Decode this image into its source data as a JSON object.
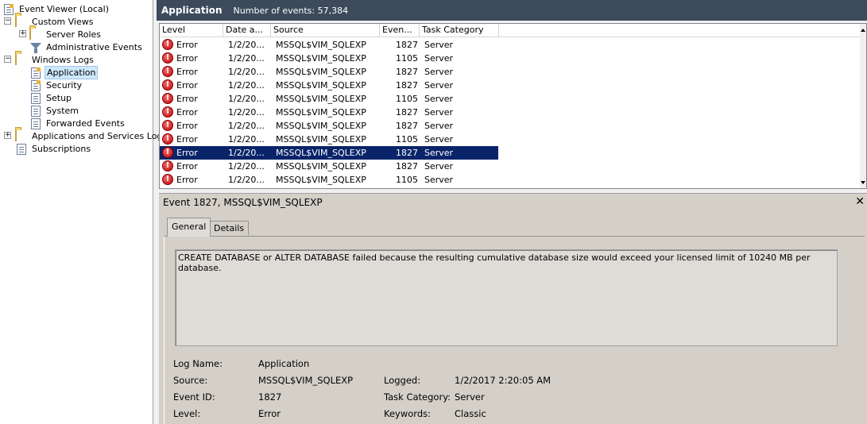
{
  "tree": {
    "items": [
      {
        "label": "Event Viewer (Local)"
      },
      {
        "label": "Custom Views"
      },
      {
        "label": "Server Roles"
      },
      {
        "label": "Administrative Events"
      },
      {
        "label": "Windows Logs"
      },
      {
        "label": "Application"
      },
      {
        "label": "Security"
      },
      {
        "label": "Setup"
      },
      {
        "label": "System"
      },
      {
        "label": "Forwarded Events"
      },
      {
        "label": "Applications and Services Logs"
      },
      {
        "label": "Subscriptions"
      }
    ]
  },
  "header": {
    "title": "Application",
    "count": "Number of events: 57,384"
  },
  "grid": {
    "columns": [
      "Level",
      "Date a...",
      "Source",
      "Even...",
      "Task Category"
    ],
    "rows": [
      {
        "level": "Error",
        "date": "1/2/20...",
        "source": "MSSQL$VIM_SQLEXP",
        "event": "1827",
        "category": "Server"
      },
      {
        "level": "Error",
        "date": "1/2/20...",
        "source": "MSSQL$VIM_SQLEXP",
        "event": "1105",
        "category": "Server"
      },
      {
        "level": "Error",
        "date": "1/2/20...",
        "source": "MSSQL$VIM_SQLEXP",
        "event": "1827",
        "category": "Server"
      },
      {
        "level": "Error",
        "date": "1/2/20...",
        "source": "MSSQL$VIM_SQLEXP",
        "event": "1827",
        "category": "Server"
      },
      {
        "level": "Error",
        "date": "1/2/20...",
        "source": "MSSQL$VIM_SQLEXP",
        "event": "1105",
        "category": "Server"
      },
      {
        "level": "Error",
        "date": "1/2/20...",
        "source": "MSSQL$VIM_SQLEXP",
        "event": "1827",
        "category": "Server"
      },
      {
        "level": "Error",
        "date": "1/2/20...",
        "source": "MSSQL$VIM_SQLEXP",
        "event": "1827",
        "category": "Server"
      },
      {
        "level": "Error",
        "date": "1/2/20...",
        "source": "MSSQL$VIM_SQLEXP",
        "event": "1105",
        "category": "Server"
      },
      {
        "level": "Error",
        "date": "1/2/20...",
        "source": "MSSQL$VIM_SQLEXP",
        "event": "1827",
        "category": "Server"
      },
      {
        "level": "Error",
        "date": "1/2/20...",
        "source": "MSSQL$VIM_SQLEXP",
        "event": "1827",
        "category": "Server"
      },
      {
        "level": "Error",
        "date": "1/2/20...",
        "source": "MSSQL$VIM_SQLEXP",
        "event": "1105",
        "category": "Server"
      }
    ]
  },
  "detail": {
    "title": "Event 1827, MSSQL$VIM_SQLEXP",
    "tabs": [
      "General",
      "Details"
    ],
    "message": "CREATE DATABASE or ALTER DATABASE failed because the resulting cumulative database size would exceed your licensed limit of 10240 MB per database.",
    "fields": {
      "log_name_label": "Log Name:",
      "log_name": "Application",
      "source_label": "Source:",
      "source": "MSSQL$VIM_SQLEXP",
      "logged_label": "Logged:",
      "logged": "1/2/2017 2:20:05 AM",
      "event_id_label": "Event ID:",
      "event_id": "1827",
      "task_category_label": "Task Category:",
      "task_category": "Server",
      "level_label": "Level:",
      "level": "Error",
      "keywords_label": "Keywords:",
      "keywords": "Classic"
    }
  },
  "colors": {
    "header_bg": "#3c4a5c",
    "selected_row": "#0a246a",
    "error_red": "#c00000"
  }
}
